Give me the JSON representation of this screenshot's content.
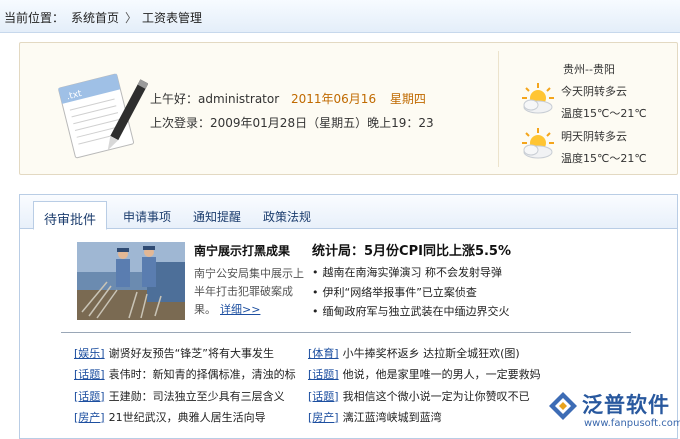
{
  "breadcrumb": {
    "label": "当前位置：",
    "home": "系统首页",
    "separator": "〉",
    "current": "工资表管理"
  },
  "welcome": {
    "greeting": "上午好：administrator",
    "date": "2011年06月16",
    "weekday": "星期四",
    "last_login": "上次登录：2009年01月28日（星期五）晚上19：23",
    "city": "贵州--贵阳",
    "today": {
      "label": "今天阴转多云",
      "temp": "温度15℃～21℃",
      "icon": "sun-cloud-icon"
    },
    "tomorrow": {
      "label": "明天阴转多云",
      "temp": "温度15℃～21℃",
      "icon": "sun-cloud-icon"
    }
  },
  "tabs": [
    {
      "label": "待审批件",
      "active": true
    },
    {
      "label": "申请事项",
      "active": false
    },
    {
      "label": "通知提醒",
      "active": false
    },
    {
      "label": "政策法规",
      "active": false
    }
  ],
  "featured": {
    "title": "南宁展示打黑成果",
    "desc": "南宁公安局集中展示上半年打击犯罪破案成果。",
    "more": "详细>>"
  },
  "headline": {
    "title": "统计局：5月份CPI同比上涨5.5%",
    "items": [
      "越南在南海实弹演习 称不会发射导弹",
      "伊利“网络举报事件”已立案侦查",
      "缅甸政府军与独立武装在中缅边界交火"
    ]
  },
  "news_left": [
    {
      "cat": "[娱乐]",
      "text": "谢贤好友预告“锋芝”将有大事发生"
    },
    {
      "cat": "[话题]",
      "text": "袁伟时：新知青的择偶标准，清浊的标"
    },
    {
      "cat": "[话题]",
      "text": "王建勋：司法独立至少具有三层含义"
    },
    {
      "cat": "[房产]",
      "text": "21世纪武汉，典雅人居生活向导"
    }
  ],
  "news_right": [
    {
      "cat": "[体育]",
      "text": "小牛捧奖杯返乡 达拉斯全城狂欢(图)"
    },
    {
      "cat": "[话题]",
      "text": "他说，他是家里唯一的男人，一定要救妈"
    },
    {
      "cat": "[话题]",
      "text": "我相信这个微小说一定为让你赞叹不已"
    },
    {
      "cat": "[房产]",
      "text": "漓江蓝湾峡城到蓝湾"
    }
  ],
  "logo": {
    "name": "泛普软件",
    "url": "www.fanpusoft.com"
  },
  "colors": {
    "accent": "#c06a00",
    "link": "#1d4fa0",
    "tab_text": "#1c3d6e",
    "border": "#b9cde5"
  }
}
